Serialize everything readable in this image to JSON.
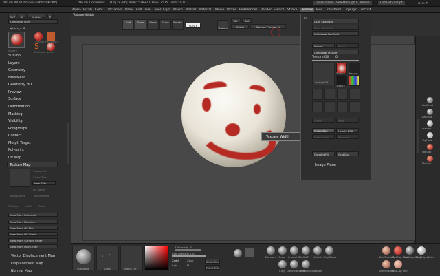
{
  "titlebar": {
    "app": "ZBrush 4R7[DSU-SHEK-AVKD-KDKY]",
    "document": "ZBrush Document",
    "stats": "[Obj: 8386] Mem: 528+41  Free: 3575  Timer: 0.013",
    "btns": [
      "Quick Save",
      "See-through 0",
      "Menus",
      "DefaultZScript"
    ]
  },
  "menubar": {
    "items": [
      "Alpha",
      "Brush",
      "Color",
      "Document",
      "Draw",
      "Edit",
      "File",
      "Layer",
      "Light",
      "Macro",
      "Marker",
      "Material",
      "Movie",
      "Picker",
      "Preferences",
      "Render",
      "Stencil",
      "Stroke",
      "Texture",
      "Tool",
      "Transform",
      "Zplugin",
      "Zscript"
    ],
    "active": "Texture"
  },
  "toolbar": {
    "title": "Texture Width",
    "buttons": [
      "Edit",
      "Draw",
      "Move",
      "Scale",
      "Rotate"
    ],
    "sdiv": "SDiv 6",
    "all": "All",
    "grid": "Grd",
    "visible": "Visible",
    "restore": "Restore Custom UI",
    "texture": "Texture"
  },
  "leftpanel": {
    "top_buttons": [
      "GoZ",
      "All",
      "Visible",
      "R"
    ],
    "lightbox": "Lightbox▸ Tools",
    "current_tool": "sphere_4 48",
    "tool_thumbs": [
      "sphere",
      "Cylinder",
      "PolyMesh",
      "Simple",
      "Displace",
      "sphere"
    ],
    "sections": [
      "SubTool",
      "Layers",
      "Geometry",
      "FiberMesh",
      "Geometry HD",
      "Preview",
      "Surface",
      "Deformation",
      "Masking",
      "Visibility",
      "Polygroups",
      "Contact",
      "Morph Target",
      "Polypaint",
      "UV Map",
      "Texture Map"
    ],
    "texmap_items": [
      "Texture On",
      "Clone Txtr",
      "New Txtr",
      "Fix Seam",
      "Transparent",
      "Antialiased"
    ],
    "row_buttons": [
      "Fill Color",
      "Unfill",
      "Clear"
    ],
    "new_from": [
      "New From Polypaint",
      "New From Masking",
      "New From UV Map",
      "New From UV Check",
      "New From Surface Order",
      "New From Poly Order"
    ],
    "bottom_sections": [
      "Vector Displacement Map",
      "Displacement Map",
      "Normal Map"
    ]
  },
  "texpanel": {
    "load_spotlight": "Load Spotlight",
    "save_spotlight": "Save Spotlight",
    "lightbox_spotlight": "Lightbox▸ Spotlight",
    "import": "Import",
    "export": "Export",
    "lightbox_texture": "Lightbox▸ Texture",
    "texture_off": "Texture Off",
    "texture_off_value": "0",
    "thumb_labels": [
      "Texture Off",
      "Texture",
      "Texture",
      "Texture"
    ],
    "clone": "Clone",
    "new": "New",
    "width_label": "Width",
    "width_value": "256",
    "height_label": "Height",
    "height_value": "256",
    "make_alpha": "MakeAlpha",
    "remove": "Remove",
    "cropfill": "CropAndFill",
    "grab": "GrabDoc",
    "image_plane": "Image Plane"
  },
  "tooltip": "Texture Width",
  "rightstrip": {
    "labels": [
      "FastShad",
      "BasicMa",
      "matcap",
      "ToyPlast",
      "MatCap",
      "MatCap"
    ]
  },
  "bottom": {
    "thumbs": [
      "Standard",
      "Dots",
      "Alpha Off"
    ],
    "z_intensity_label": "Z Intensity",
    "z_intensity": "25",
    "rgb_intensity_label": "Rgb Intensity",
    "rgb_intensity": "100",
    "zadd": "Zadd",
    "zsub": "Zsub",
    "mrgb": "Mrgb",
    "rgb": "Rgb",
    "m": "M",
    "draw_size": "Draw Size",
    "lazy": "Lazy",
    "focal_shift": "Focal Shift",
    "brushes": [
      "Standard",
      "Move",
      "SmoothS",
      "InflatP",
      "hPolish",
      "ClayTubes",
      "Clay",
      "DamStandard",
      "ClayBuildup",
      "Pinch"
    ],
    "materials": [
      "SkinShade4",
      "MatCap Red",
      "MatCap Gray",
      "MatCap White",
      "SkinShade4",
      "MatCap Skin"
    ]
  },
  "colors": {
    "brush_red": "#b52a23",
    "panel_bg": "#2d2d2d",
    "canvas_bg": "#484848",
    "header_text": "#dddddd"
  }
}
